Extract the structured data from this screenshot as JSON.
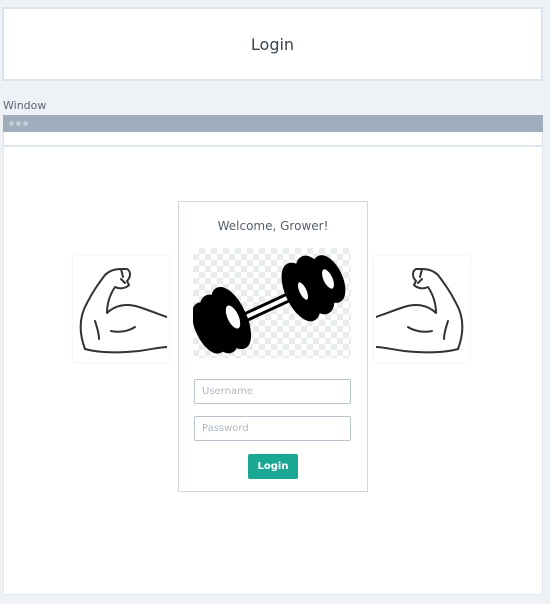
{
  "header": {
    "title": "Login"
  },
  "window": {
    "label": "Window"
  },
  "login_card": {
    "welcome": "Welcome, Grower!",
    "username_placeholder": "Username",
    "password_placeholder": "Password",
    "login_label": "Login"
  },
  "icons": {
    "left_arm": "flexed-arm-icon",
    "right_arm": "flexed-arm-icon",
    "dumbbell": "dumbbell-icon"
  },
  "colors": {
    "accent": "#1aa894",
    "titlebar": "#9fadbd",
    "page_bg": "#eef1f5"
  }
}
